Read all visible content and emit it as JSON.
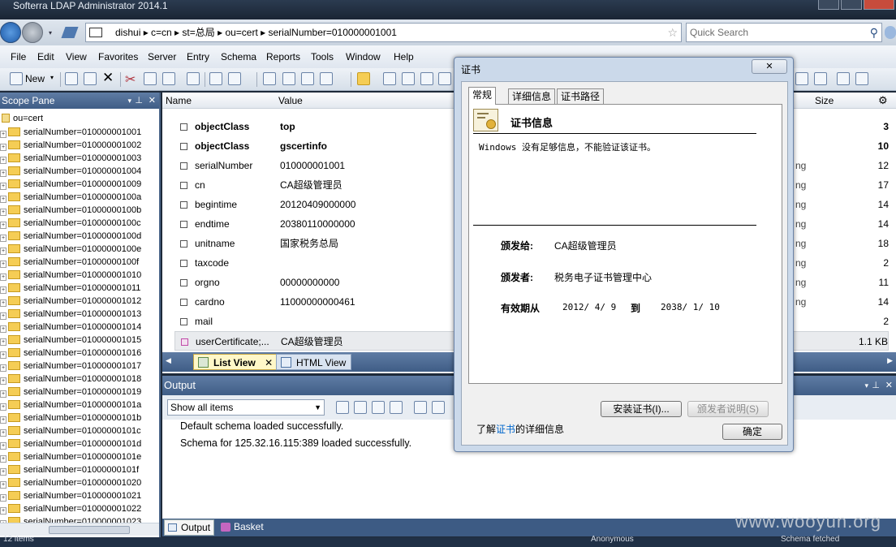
{
  "window": {
    "title": "Softerra LDAP Administrator 2014.1"
  },
  "address": {
    "path": "dishui   ▸   c=cn   ▸   st=总局   ▸   ou=cert   ▸   serialNumber=010000001001",
    "quick_search_placeholder": "Quick Search"
  },
  "menu": [
    "File",
    "Edit",
    "View",
    "Favorites",
    "Server",
    "Entry",
    "Schema",
    "Reports",
    "Tools",
    "Window",
    "Help"
  ],
  "toolbar": {
    "new_label": "New"
  },
  "scope_pane": {
    "title": "Scope Pane",
    "root": "ou=cert",
    "items": [
      "serialNumber=010000001001",
      "serialNumber=010000001002",
      "serialNumber=010000001003",
      "serialNumber=010000001004",
      "serialNumber=010000001009",
      "serialNumber=01000000100a",
      "serialNumber=01000000100b",
      "serialNumber=01000000100c",
      "serialNumber=01000000100d",
      "serialNumber=01000000100e",
      "serialNumber=01000000100f",
      "serialNumber=010000001010",
      "serialNumber=010000001011",
      "serialNumber=010000001012",
      "serialNumber=010000001013",
      "serialNumber=010000001014",
      "serialNumber=010000001015",
      "serialNumber=010000001016",
      "serialNumber=010000001017",
      "serialNumber=010000001018",
      "serialNumber=010000001019",
      "serialNumber=01000000101a",
      "serialNumber=01000000101b",
      "serialNumber=01000000101c",
      "serialNumber=01000000101d",
      "serialNumber=01000000101e",
      "serialNumber=01000000101f",
      "serialNumber=010000001020",
      "serialNumber=010000001021",
      "serialNumber=010000001022",
      "serialNumber=010000001023"
    ]
  },
  "list": {
    "columns": {
      "name": "Name",
      "value": "Value",
      "size": "Size"
    },
    "rows": [
      {
        "name": "objectClass",
        "value": "top",
        "type": "",
        "size": "3",
        "bold": true
      },
      {
        "name": "objectClass",
        "value": "gscertinfo",
        "type": "",
        "size": "10",
        "bold": true
      },
      {
        "name": "serialNumber",
        "value": "010000001001",
        "type": "ng",
        "size": "12"
      },
      {
        "name": "cn",
        "value": "CA超级管理员",
        "type": "ng",
        "size": "17"
      },
      {
        "name": "begintime",
        "value": "20120409000000",
        "type": "ng",
        "size": "14"
      },
      {
        "name": "endtime",
        "value": "20380110000000",
        "type": "ng",
        "size": "14"
      },
      {
        "name": "unitname",
        "value": "国家税务总局",
        "type": "ng",
        "size": "18"
      },
      {
        "name": "taxcode",
        "value": "",
        "type": "ng",
        "size": "2"
      },
      {
        "name": "orgno",
        "value": "00000000000",
        "type": "ng",
        "size": "11"
      },
      {
        "name": "cardno",
        "value": "11000000000461",
        "type": "ng",
        "size": "14"
      },
      {
        "name": "mail",
        "value": "",
        "type": "",
        "size": "2"
      },
      {
        "name": "userCertificate;...",
        "value": "CA超级管理员",
        "type": "",
        "size": "1.1 KB",
        "selected": true
      }
    ],
    "view_tabs": [
      "List View",
      "HTML View"
    ]
  },
  "output": {
    "title": "Output",
    "filter": "Show all items",
    "lines": [
      "Default schema loaded successfully.",
      "Schema for 125.32.16.115:389 loaded successfully."
    ],
    "bottom_tabs": [
      "Output",
      "Basket"
    ]
  },
  "status": {
    "left": "12 items",
    "mid": "Anonymous",
    "right": "Schema fetched"
  },
  "cert_dialog": {
    "title": "证书",
    "tabs": [
      "常规",
      "详细信息",
      "证书路径"
    ],
    "heading": "证书信息",
    "warning": "Windows 没有足够信息，不能验证该证书。",
    "issued_to_label": "颁发给:",
    "issued_to": "CA超级管理员",
    "issued_by_label": "颁发者:",
    "issued_by": "税务电子证书管理中心",
    "validity_label": "有效期从",
    "valid_from": "2012/ 4/ 9",
    "to_label": "到",
    "valid_to": "2038/ 1/ 10",
    "install_button": "安装证书(I)...",
    "statement_button": "颁发者说明(S)",
    "learn_more_prefix": "了解",
    "learn_more_link": "证书",
    "learn_more_suffix": "的详细信息",
    "ok_button": "确定"
  },
  "watermark": "www.wooyun.org"
}
